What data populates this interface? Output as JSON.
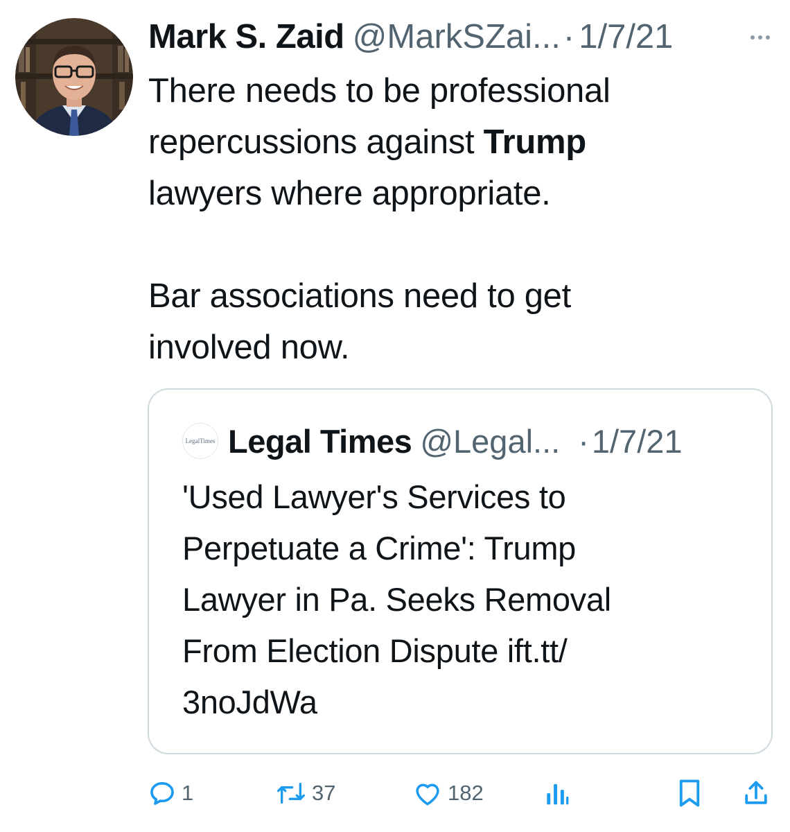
{
  "tweet": {
    "author_name": "Mark S. Zaid",
    "author_handle": "@MarkSZai...",
    "separator": "·",
    "date": "1/7/21",
    "text_line1": "There needs to be professional",
    "text_line2_prefix": "repercussions against ",
    "text_line2_bold": "Trump",
    "text_line3": "lawyers where appropriate.",
    "text_para2_line1": "Bar associations need to get",
    "text_para2_line2": "involved now."
  },
  "quoted_tweet": {
    "avatar_text": "LegalTimes",
    "author_name": "Legal Times",
    "author_handle": "@Legal...",
    "separator": "·",
    "date": "1/7/21",
    "text_line1": "'Used Lawyer's Services to",
    "text_line2": "Perpetuate a Crime': Trump",
    "text_line3": "Lawyer in Pa. Seeks Removal",
    "text_line4": "From Election Dispute ift.tt/",
    "text_line5": "3noJdWa"
  },
  "actions": {
    "reply_count": "1",
    "retweet_count": "37",
    "like_count": "182"
  },
  "icons": {
    "reply": "reply-icon",
    "retweet": "retweet-icon",
    "like": "heart-icon",
    "views": "views-icon",
    "bookmark": "bookmark-icon",
    "share": "share-icon",
    "more": "more-icon"
  },
  "colors": {
    "text": "#0f1419",
    "secondary": "#536471",
    "border": "#cfd9de"
  }
}
